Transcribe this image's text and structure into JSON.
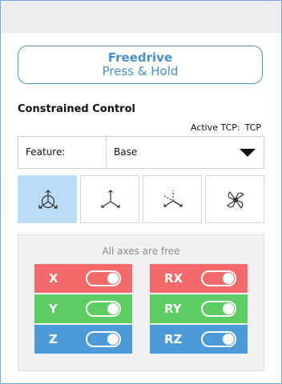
{
  "freedrive": {
    "line1": "Freedrive",
    "line2": "Press & Hold"
  },
  "constrained": {
    "title": "Constrained Control",
    "active_tcp_label": "Active TCP:",
    "active_tcp_value": "TCP"
  },
  "feature": {
    "label": "Feature:",
    "value": "Base"
  },
  "view_buttons": [
    {
      "icon": "axes-free-icon",
      "active": true
    },
    {
      "icon": "axes-icon",
      "active": false
    },
    {
      "icon": "axes-dashed-icon",
      "active": false
    },
    {
      "icon": "rotate-icon",
      "active": false
    }
  ],
  "axes": {
    "status": "All axes are free",
    "list": [
      {
        "label": "X",
        "color": "#f26a6a",
        "enabled": true
      },
      {
        "label": "RX",
        "color": "#f26a6a",
        "enabled": true
      },
      {
        "label": "Y",
        "color": "#5dcc63",
        "enabled": true
      },
      {
        "label": "RY",
        "color": "#5dcc63",
        "enabled": true
      },
      {
        "label": "Z",
        "color": "#4d9ad8",
        "enabled": true
      },
      {
        "label": "RZ",
        "color": "#4d9ad8",
        "enabled": true
      }
    ]
  }
}
